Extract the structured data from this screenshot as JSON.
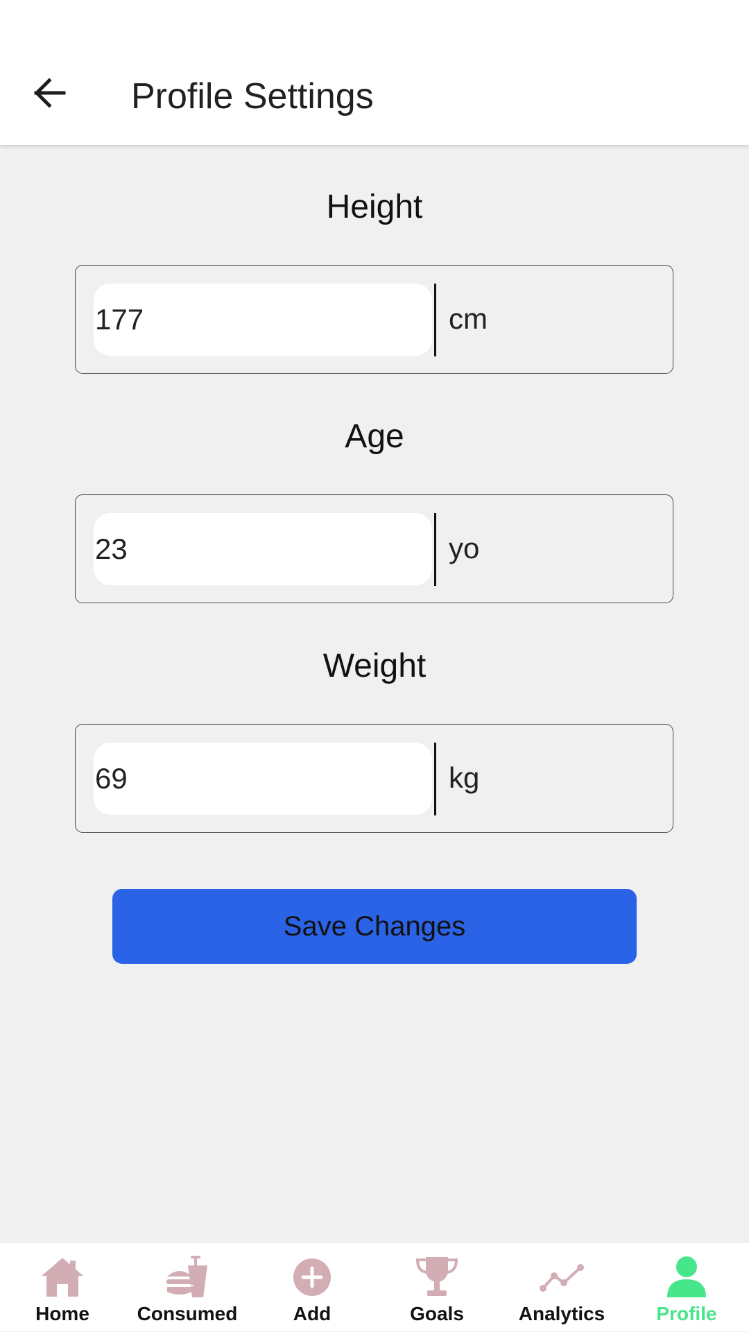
{
  "header": {
    "title": "Profile Settings",
    "back_icon": "arrow-left-icon"
  },
  "fields": [
    {
      "label": "Height",
      "value": "177",
      "unit": "cm"
    },
    {
      "label": "Age",
      "value": "23",
      "unit": "yo"
    },
    {
      "label": "Weight",
      "value": "69",
      "unit": "kg"
    }
  ],
  "actions": {
    "save_label": "Save Changes"
  },
  "nav": {
    "items": [
      {
        "label": "Home",
        "icon": "home-icon",
        "active": false
      },
      {
        "label": "Consumed",
        "icon": "burger-drink-icon",
        "active": false
      },
      {
        "label": "Add",
        "icon": "add-circle-icon",
        "active": false
      },
      {
        "label": "Goals",
        "icon": "trophy-icon",
        "active": false
      },
      {
        "label": "Analytics",
        "icon": "line-chart-icon",
        "active": false
      },
      {
        "label": "Profile",
        "icon": "person-icon",
        "active": true
      }
    ]
  },
  "colors": {
    "accent": "#2b63e6",
    "active_nav": "#47e68a",
    "inactive_icon": "#d3adb4",
    "background": "#f0f0f0"
  }
}
